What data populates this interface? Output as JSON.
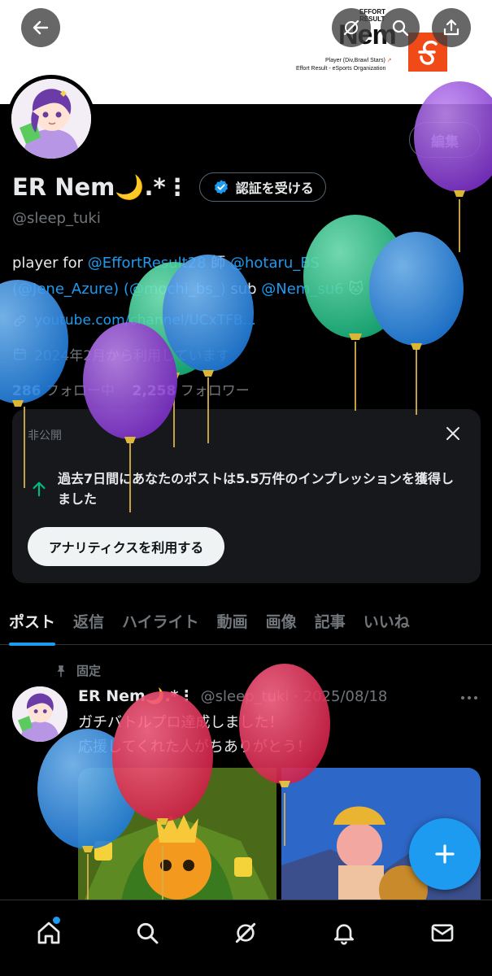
{
  "banner": {
    "brand_small": "EFFORT\nRESULT",
    "brand_name": "Nem",
    "brand_player": "Player (Div,Brawl Stars)",
    "brand_org": "Effort Result - eSports Organization"
  },
  "profile": {
    "edit_label": "編集",
    "display_name": "ER Nem🌙.*⋮",
    "verify_label": "認証を受ける",
    "handle": "@sleep_tuki",
    "bio_prefix": "player for ",
    "bio_mention1": "@EffortResult28",
    "bio_mid1": " 師 ",
    "bio_mention2": "@hotaru_BS",
    "bio_mention3": "(@Jene_Azure)",
    "bio_mid2": " ",
    "bio_mention4": "(@mochi_bs_)",
    "bio_mid3": " sub ",
    "bio_mention5": "@Nem_su6",
    "bio_emoji": "🐱",
    "link": "youtube.com/channel/UCxTFB...",
    "joined": "2024年2月から利用しています",
    "following_count": "286",
    "following_label": " フォロー中",
    "followers_count": "2,258",
    "followers_label": " フォロワー"
  },
  "analytics_card": {
    "label": "非公開",
    "text": "過去7日間にあなたのポストは5.5万件のインプレッションを獲得しました",
    "button": "アナリティクスを利用する"
  },
  "tabs": [
    "ポスト",
    "返信",
    "ハイライト",
    "動画",
    "画像",
    "記事",
    "いいね"
  ],
  "pinned_post": {
    "pin_label": "固定",
    "name": "ER Nem🌙.*⋮",
    "meta": "@sleep_tuki · 2025/08/18",
    "line1": "ガチバトルプロ達成しました！",
    "line2": "応援してくれた人がちありがとう！"
  },
  "colors": {
    "accent": "#1d9bf0",
    "background": "#000000",
    "muted": "#71767b",
    "card_bg": "#16181c",
    "brand_orange": "#f04a19"
  },
  "icons": {
    "back": "arrow-left-icon",
    "grok": "grok-icon",
    "search": "search-icon",
    "share": "share-icon",
    "verified": "verified-badge-icon",
    "link": "link-icon",
    "calendar": "calendar-icon",
    "close": "close-icon",
    "up": "arrow-up-icon",
    "pin": "pin-icon",
    "more": "more-icon",
    "compose": "plus-icon",
    "home": "home-icon",
    "notifications": "bell-icon",
    "messages": "mail-icon"
  }
}
